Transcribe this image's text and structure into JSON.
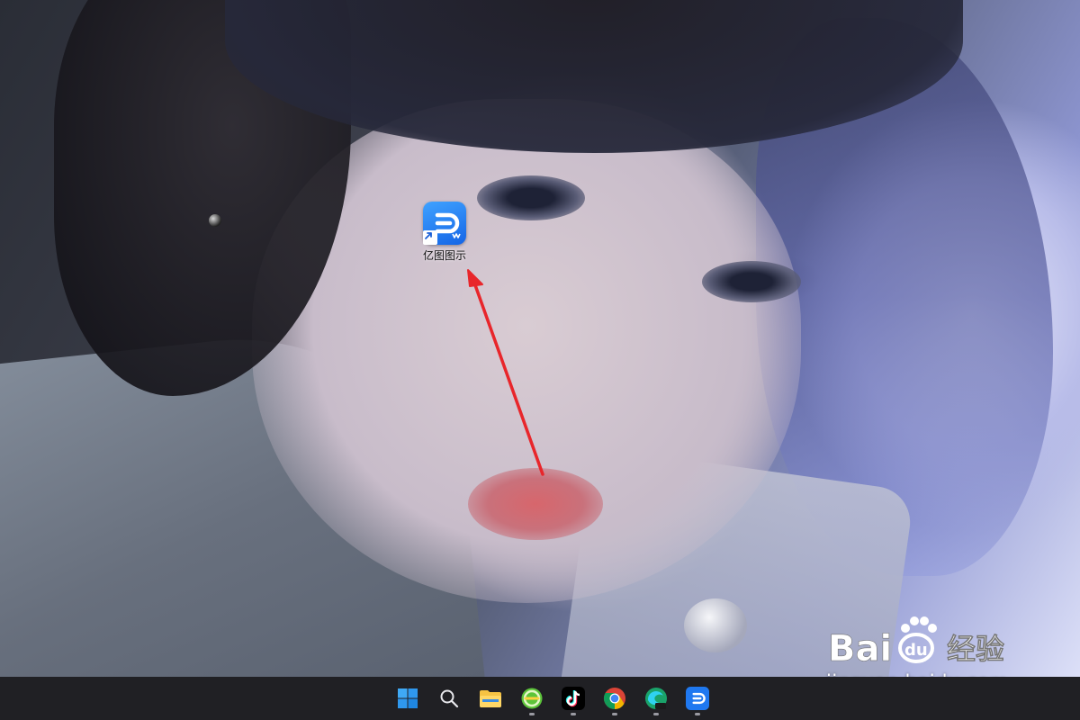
{
  "desktop": {
    "shortcut": {
      "label": "亿图图示",
      "icon": "edraw-max-icon"
    }
  },
  "taskbar": {
    "items": [
      {
        "name": "Start",
        "icon": "windows-start-icon",
        "running": false
      },
      {
        "name": "Search",
        "icon": "search-icon",
        "running": false
      },
      {
        "name": "File Explorer",
        "icon": "folder-icon",
        "running": false
      },
      {
        "name": "360 Browser",
        "icon": "browser-360-icon",
        "running": true
      },
      {
        "name": "TikTok",
        "icon": "tiktok-icon",
        "running": true
      },
      {
        "name": "Google Chrome",
        "icon": "chrome-icon",
        "running": true
      },
      {
        "name": "Microsoft Edge Dev",
        "icon": "edge-dev-icon",
        "running": true
      },
      {
        "name": "亿图图示",
        "icon": "edraw-max-icon",
        "running": true
      }
    ]
  },
  "watermark": {
    "brand": "Bai du 经验",
    "domain": "jingyan.baidu.com"
  },
  "colors": {
    "taskbar_bg": "#202024",
    "annotation_arrow": "#e8262b",
    "shortcut_icon": "#1f78f0"
  }
}
